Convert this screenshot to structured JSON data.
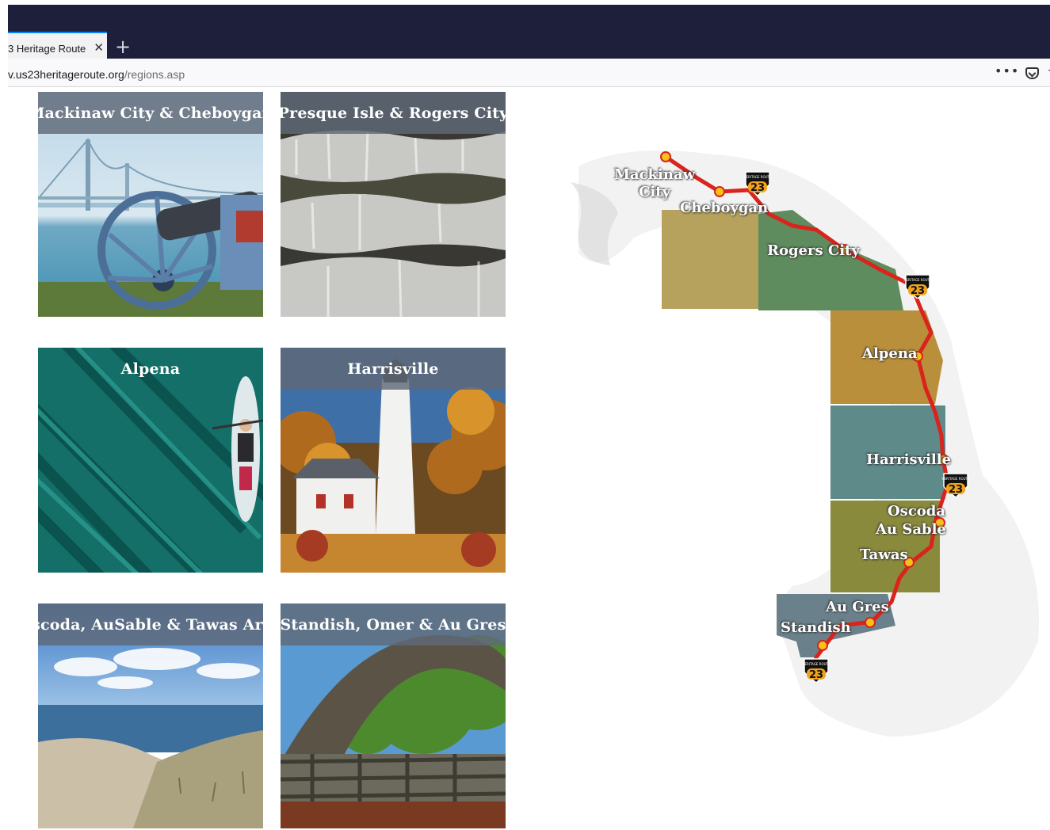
{
  "browser": {
    "tab_title": "3 Heritage Route",
    "tab_close": "✕",
    "new_tab": "+",
    "url_host": "v.us23heritageroute.org",
    "url_path": "/regions.asp",
    "page_actions": "•••",
    "star": "☆"
  },
  "regions": [
    {
      "label": "Mackinaw City & Cheboygan"
    },
    {
      "label": "Presque Isle & Rogers City"
    },
    {
      "label": "Alpena"
    },
    {
      "label": "Harrisville"
    },
    {
      "label": "Oscoda, AuSable & Tawas Area"
    },
    {
      "label": "Standish, Omer & Au Gres"
    }
  ],
  "map": {
    "places": [
      {
        "label": "Mackinaw\nCity"
      },
      {
        "label": "Cheboygan"
      },
      {
        "label": "Rogers City"
      },
      {
        "label": "Alpena"
      },
      {
        "label": "Harrisville"
      },
      {
        "label": "Oscoda"
      },
      {
        "label": "Au Sable"
      },
      {
        "label": "Tawas"
      },
      {
        "label": "Au Gres"
      },
      {
        "label": "Standish"
      }
    ],
    "shield_top": "HERITAGE ROUTE",
    "shield_number": "23",
    "colors": {
      "route": "#d9231c",
      "stop": "#f6c21a",
      "region1": "#b6a25c",
      "region2": "#5f8c5e",
      "region3": "#b98f3b",
      "region4": "#5f8a8a",
      "region5": "#8a8a3c",
      "region6": "#6a808a"
    }
  }
}
